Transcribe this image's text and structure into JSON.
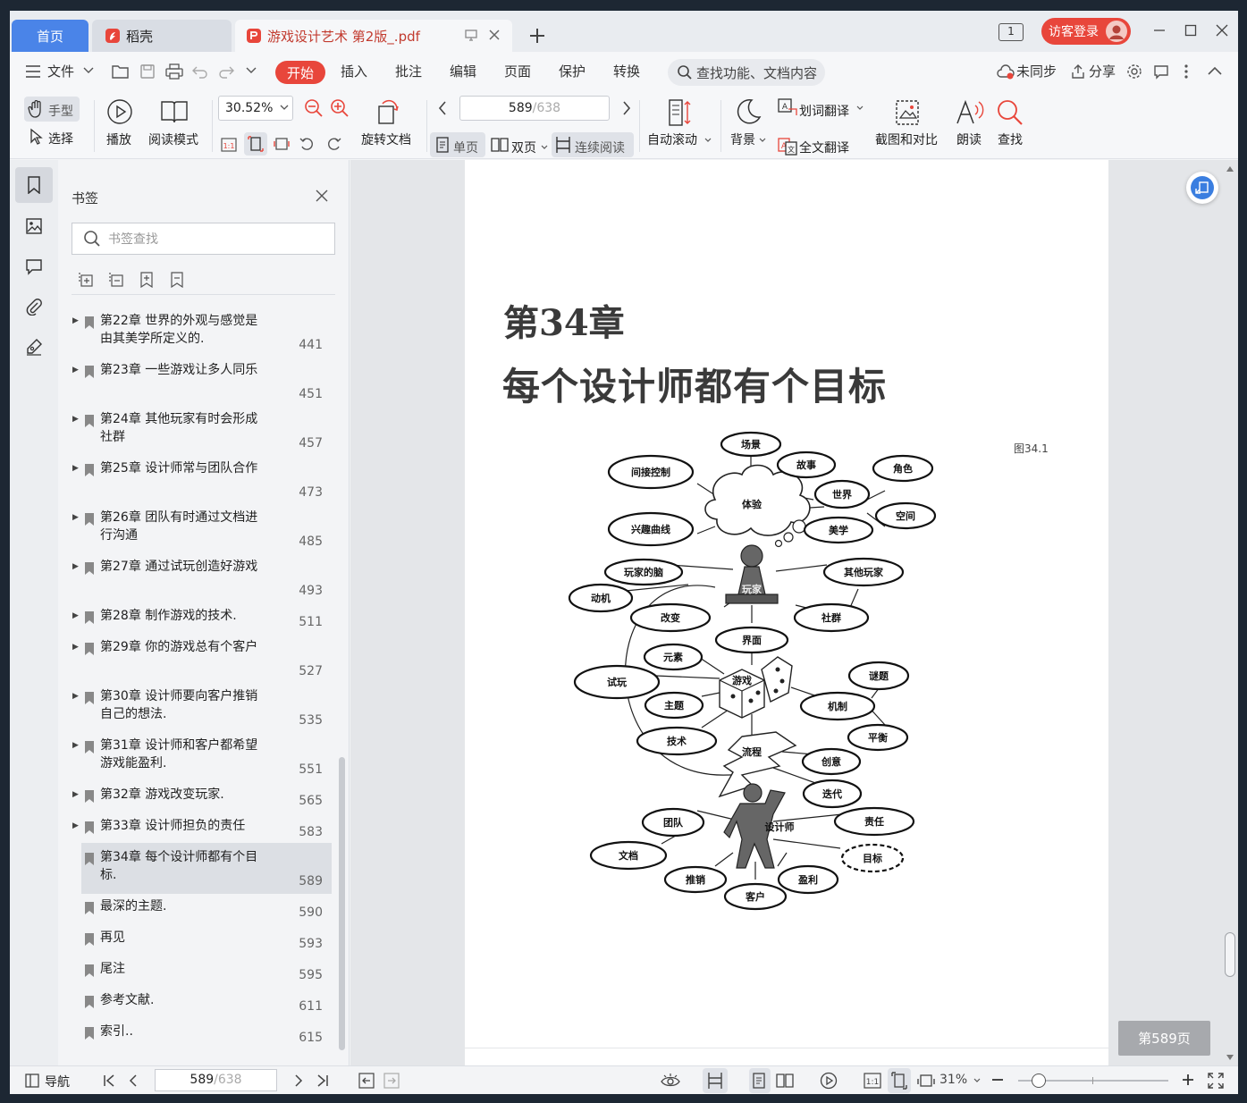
{
  "window": {
    "tabs": {
      "home": "首页",
      "daoke": "稻壳",
      "document": "游戏设计艺术 第2版_.pdf"
    },
    "badge_count": "1",
    "login_button": "访客登录"
  },
  "menu": {
    "file": "文件",
    "start": "开始",
    "insert": "插入",
    "annotate": "批注",
    "edit": "编辑",
    "page": "页面",
    "protect": "保护",
    "convert": "转换",
    "search_placeholder": "查找功能、文档内容",
    "sync": "未同步",
    "share": "分享"
  },
  "toolbar": {
    "hand": "手型",
    "select": "选择",
    "play": "播放",
    "read_mode": "阅读模式",
    "zoom": "30.52%",
    "rotate": "旋转文档",
    "page_current": "589",
    "page_total": "/638",
    "single": "单页",
    "double": "双页",
    "continuous": "连续阅读",
    "auto_scroll": "自动滚动",
    "background": "背景",
    "word_translate": "划词翻译",
    "full_translate": "全文翻译",
    "screenshot_compare": "截图和对比",
    "read_aloud": "朗读",
    "find": "查找"
  },
  "bookmark_panel": {
    "title": "书签",
    "search_placeholder": "书签查找",
    "items": [
      {
        "text": "第22章 世界的外观与感觉是由其美学所定义的.",
        "page": "441",
        "expandable": true
      },
      {
        "text": "第23章 一些游戏让多人同乐",
        "page": "451",
        "expandable": true
      },
      {
        "text": "第24章 其他玩家有时会形成社群",
        "page": "457",
        "expandable": true
      },
      {
        "text": "第25章 设计师常与团队合作",
        "page": "473",
        "expandable": true
      },
      {
        "text": "第26章 团队有时通过文档进行沟通",
        "page": "485",
        "expandable": true
      },
      {
        "text": "第27章 通过试玩创造好游戏",
        "page": "493",
        "expandable": true
      },
      {
        "text": "第28章 制作游戏的技术.",
        "page": "511",
        "expandable": true
      },
      {
        "text": "第29章 你的游戏总有个客户",
        "page": "527",
        "expandable": true
      },
      {
        "text": "第30章 设计师要向客户推销自己的想法.",
        "page": "535",
        "expandable": true
      },
      {
        "text": "第31章 设计师和客户都希望游戏能盈利.",
        "page": "551",
        "expandable": true
      },
      {
        "text": "第32章 游戏改变玩家.",
        "page": "565",
        "expandable": true
      },
      {
        "text": "第33章 设计师担负的责任",
        "page": "583",
        "expandable": true
      },
      {
        "text": "第34章 每个设计师都有个目标.",
        "page": "589",
        "expandable": false,
        "selected": true
      },
      {
        "text": "最深的主题.",
        "page": "590",
        "expandable": false
      },
      {
        "text": "再见",
        "page": "593",
        "expandable": false
      },
      {
        "text": "尾注",
        "page": "595",
        "expandable": false
      },
      {
        "text": "参考文献.",
        "page": "611",
        "expandable": false
      },
      {
        "text": "索引..",
        "page": "615",
        "expandable": false
      }
    ]
  },
  "document_page": {
    "chapter": "第34章",
    "title": "每个设计师都有个目标",
    "figure_label": "图34.1",
    "diagram_nodes": {
      "scene": "场景",
      "story": "故事",
      "character": "角色",
      "indirect": "间接控制",
      "experience": "体验",
      "world": "世界",
      "space": "空间",
      "interest": "兴趣曲线",
      "aesthetics": "美学",
      "brain": "玩家的脑",
      "others": "其他玩家",
      "motivation": "动机",
      "player": "玩家",
      "change": "改变",
      "community": "社群",
      "interface": "界面",
      "elements": "元素",
      "puzzle": "谜题",
      "playtest": "试玩",
      "game": "游戏",
      "theme": "主题",
      "mechanics": "机制",
      "balance": "平衡",
      "technology": "技术",
      "flow": "流程",
      "creativity": "创意",
      "iteration": "迭代",
      "team": "团队",
      "responsibility": "责任",
      "designer": "设计师",
      "documents": "文档",
      "goal": "目标",
      "pitch": "推销",
      "profit": "盈利",
      "client": "客户"
    },
    "page_badge": "第589页"
  },
  "statusbar": {
    "nav": "导航",
    "page_current": "589",
    "page_total": "/638",
    "zoom": "31%"
  },
  "colors": {
    "accent_red": "#e8463b",
    "accent_blue": "#4a84e8"
  }
}
